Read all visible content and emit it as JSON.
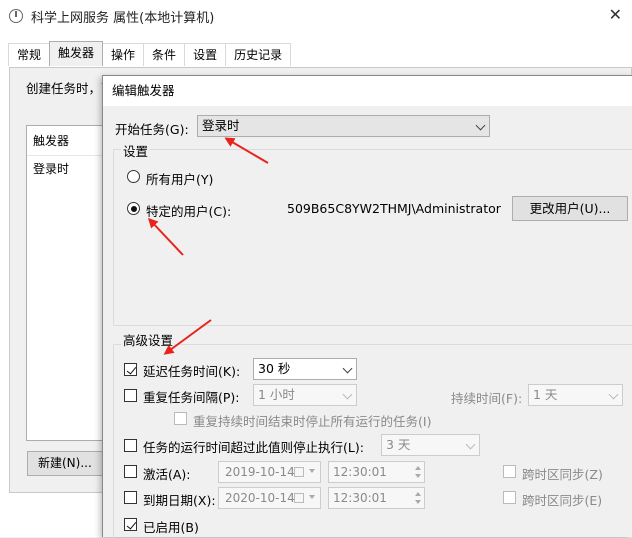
{
  "window": {
    "title": "科学上网服务 属性(本地计算机)",
    "close": "✕"
  },
  "tabs": [
    {
      "label": "常规"
    },
    {
      "label": "触发器"
    },
    {
      "label": "操作"
    },
    {
      "label": "条件"
    },
    {
      "label": "设置"
    },
    {
      "label": "历史记录"
    }
  ],
  "background": {
    "description": "创建任务时，可",
    "list_header": "触发器",
    "list_rows": [
      "登录时"
    ],
    "new_button": "新建(N)..."
  },
  "dialog": {
    "title": "编辑触发器",
    "start_task_label": "开始任务(G):",
    "start_task_value": "登录时",
    "settings_group": "设置",
    "radio_all_users": "所有用户(Y)",
    "radio_specific_user": "特定的用户(C):",
    "user_name": "509B65C8YW2THMJ\\Administrator",
    "change_user_button": "更改用户(U)...",
    "advanced_group": "高级设置",
    "delay": {
      "label": "延迟任务时间(K):",
      "value": "30 秒",
      "checked": true
    },
    "repeat": {
      "label": "重复任务间隔(P):",
      "value": "1 小时",
      "checked": false
    },
    "duration_label": "持续时间(F):",
    "duration_value": "1 天",
    "stop_repeat_label": "重复持续时间结束时停止所有运行的任务(I)",
    "stop_if_longer": {
      "label": "任务的运行时间超过此值则停止执行(L):",
      "value": "3 天",
      "checked": false
    },
    "activate": {
      "label": "激活(A):",
      "date": "2019-10-14",
      "time": "12:30:01",
      "sync_label": "跨时区同步(Z)"
    },
    "expire": {
      "label": "到期日期(X):",
      "date": "2020-10-14",
      "time": "12:30:01",
      "sync_label": "跨时区同步(E)"
    },
    "enabled": {
      "label": "已启用(B)",
      "checked": true
    }
  },
  "colors": {
    "annotation_arrow": "#e8231c"
  }
}
